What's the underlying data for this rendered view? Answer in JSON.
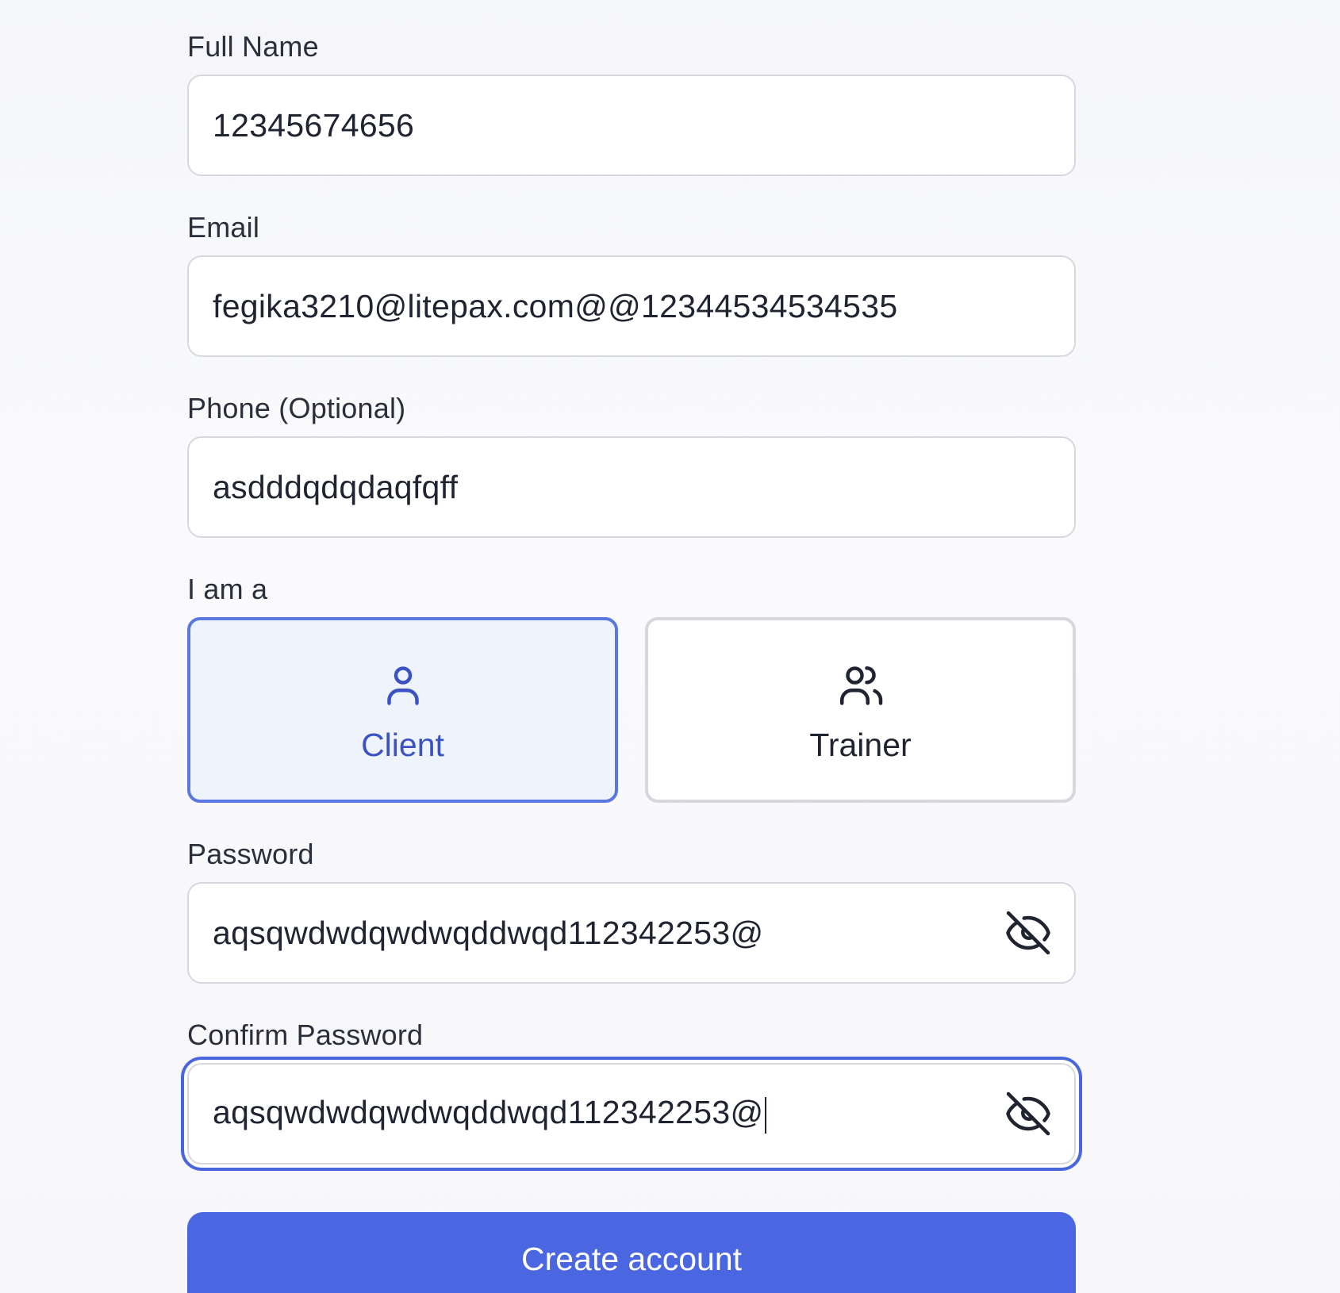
{
  "form": {
    "full_name": {
      "label": "Full Name",
      "value": "12345674656"
    },
    "email": {
      "label": "Email",
      "value": "fegika3210@litepax.com@@12344534534535"
    },
    "phone": {
      "label": "Phone (Optional)",
      "value": "asdddqdqdaqfqff"
    },
    "role": {
      "label": "I am a",
      "selected": "Client",
      "options": [
        {
          "label": "Client",
          "icon": "user-icon"
        },
        {
          "label": "Trainer",
          "icon": "users-icon"
        }
      ]
    },
    "password": {
      "label": "Password",
      "value": "aqsqwdwdqwdwqddwqd112342253@",
      "toggle_icon": "eye-off-icon"
    },
    "confirm_password": {
      "label": "Confirm Password",
      "value": "aqsqwdwdqwdwqddwqd112342253@",
      "toggle_icon": "eye-off-icon",
      "focused": true
    },
    "submit_label": "Create account"
  },
  "colors": {
    "accent": "#4a66e1",
    "selected_bg": "#eff3fb",
    "selected_text": "#3a52c4",
    "border": "#d6d8de"
  }
}
